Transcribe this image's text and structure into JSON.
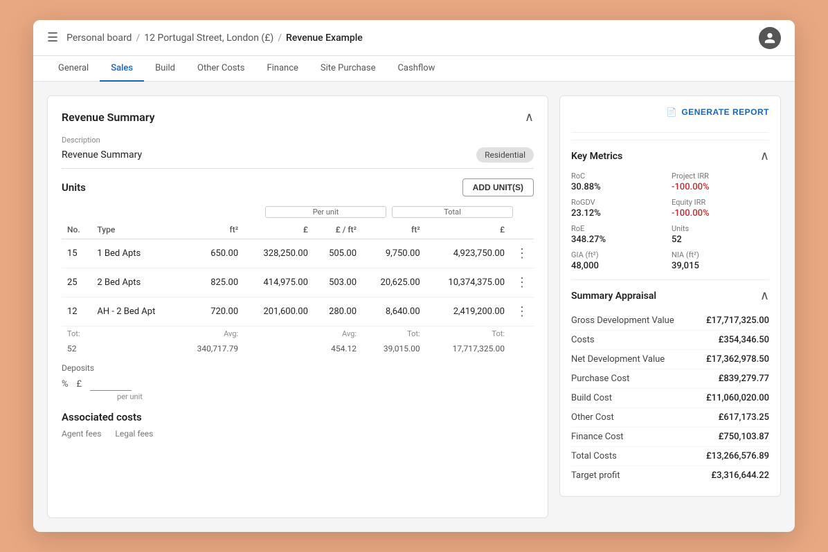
{
  "app": {
    "menu_icon": "☰",
    "breadcrumb": {
      "part1": "Personal board",
      "sep1": "/",
      "part2": "12 Portugal Street, London (£)",
      "sep2": "/",
      "current": "Revenue Example"
    },
    "avatar_icon": "👤"
  },
  "tabs": [
    {
      "id": "general",
      "label": "General",
      "active": false
    },
    {
      "id": "sales",
      "label": "Sales",
      "active": true
    },
    {
      "id": "build",
      "label": "Build",
      "active": false
    },
    {
      "id": "other-costs",
      "label": "Other Costs",
      "active": false
    },
    {
      "id": "finance",
      "label": "Finance",
      "active": false
    },
    {
      "id": "site-purchase",
      "label": "Site Purchase",
      "active": false
    },
    {
      "id": "cashflow",
      "label": "Cashflow",
      "active": false
    }
  ],
  "left_panel": {
    "title": "Revenue Summary",
    "description_label": "Description",
    "description_value": "Revenue Summary",
    "badge": "Residential",
    "units_title": "Units",
    "add_units_btn": "ADD UNIT(S)",
    "col_groups": {
      "per_unit": "Per unit",
      "total": "Total"
    },
    "table_headers": [
      "No.",
      "Type",
      "ft²",
      "£",
      "£ / ft²",
      "ft²",
      "£"
    ],
    "table_rows": [
      {
        "no": "15",
        "type": "1 Bed Apts",
        "ft2": "650.00",
        "gbp": "328,250.00",
        "gbp_ft2": "505.00",
        "total_ft2": "9,750.00",
        "total_gbp": "4,923,750.00"
      },
      {
        "no": "25",
        "type": "2 Bed Apts",
        "ft2": "825.00",
        "gbp": "414,975.00",
        "gbp_ft2": "503.00",
        "total_ft2": "20,625.00",
        "total_gbp": "10,374,375.00"
      },
      {
        "no": "12",
        "type": "AH - 2 Bed Apt",
        "ft2": "720.00",
        "gbp": "201,600.00",
        "gbp_ft2": "280.00",
        "total_ft2": "8,640.00",
        "total_gbp": "2,419,200.00"
      }
    ],
    "totals": {
      "no_label": "Tot:",
      "no_val": "52",
      "ft2_label": "Avg:",
      "ft2_val": "340,717.79",
      "gbp_ft2_label": "Avg:",
      "gbp_ft2_val": "454.12",
      "total_ft2_label": "Tot:",
      "total_ft2_val": "39,015.00",
      "total_gbp_label": "Tot:",
      "total_gbp_val": "17,717,325.00"
    },
    "deposits_label": "Deposits",
    "deposits_pct_placeholder": "%",
    "deposits_gbp_placeholder": "£",
    "per_unit_label": "per unit",
    "assoc_costs_title": "Associated costs",
    "agent_fees_label": "Agent fees",
    "legal_fees_label": "Legal fees"
  },
  "right_panel": {
    "generate_report_btn": "GENERATE REPORT",
    "report_icon": "📄",
    "key_metrics_title": "Key Metrics",
    "metrics": [
      {
        "label": "RoC",
        "value": "30.88%",
        "negative": false
      },
      {
        "label": "Project IRR",
        "value": "-100.00%",
        "negative": true
      },
      {
        "label": "RoGDV",
        "value": "23.12%",
        "negative": false
      },
      {
        "label": "Equity IRR",
        "value": "-100.00%",
        "negative": true
      },
      {
        "label": "RoE",
        "value": "348.27%",
        "negative": false
      },
      {
        "label": "Units",
        "value": "52",
        "negative": false
      },
      {
        "label": "GIA (ft²)",
        "value": "48,000",
        "negative": false
      },
      {
        "label": "NIA (ft²)",
        "value": "39,015",
        "negative": false
      }
    ],
    "summary_appraisal_title": "Summary Appraisal",
    "summary_rows": [
      {
        "label": "Gross Development Value",
        "value": "£17,717,325.00"
      },
      {
        "label": "Costs",
        "value": "£354,346.50"
      },
      {
        "label": "Net Development Value",
        "value": "£17,362,978.50"
      },
      {
        "label": "Purchase Cost",
        "value": "£839,279.77"
      },
      {
        "label": "Build Cost",
        "value": "£11,060,020.00"
      },
      {
        "label": "Other Cost",
        "value": "£617,173.25"
      },
      {
        "label": "Finance Cost",
        "value": "£750,103.87"
      },
      {
        "label": "Total Costs",
        "value": "£13,266,576.89"
      },
      {
        "label": "Target profit",
        "value": "£3,316,644.22"
      }
    ]
  }
}
